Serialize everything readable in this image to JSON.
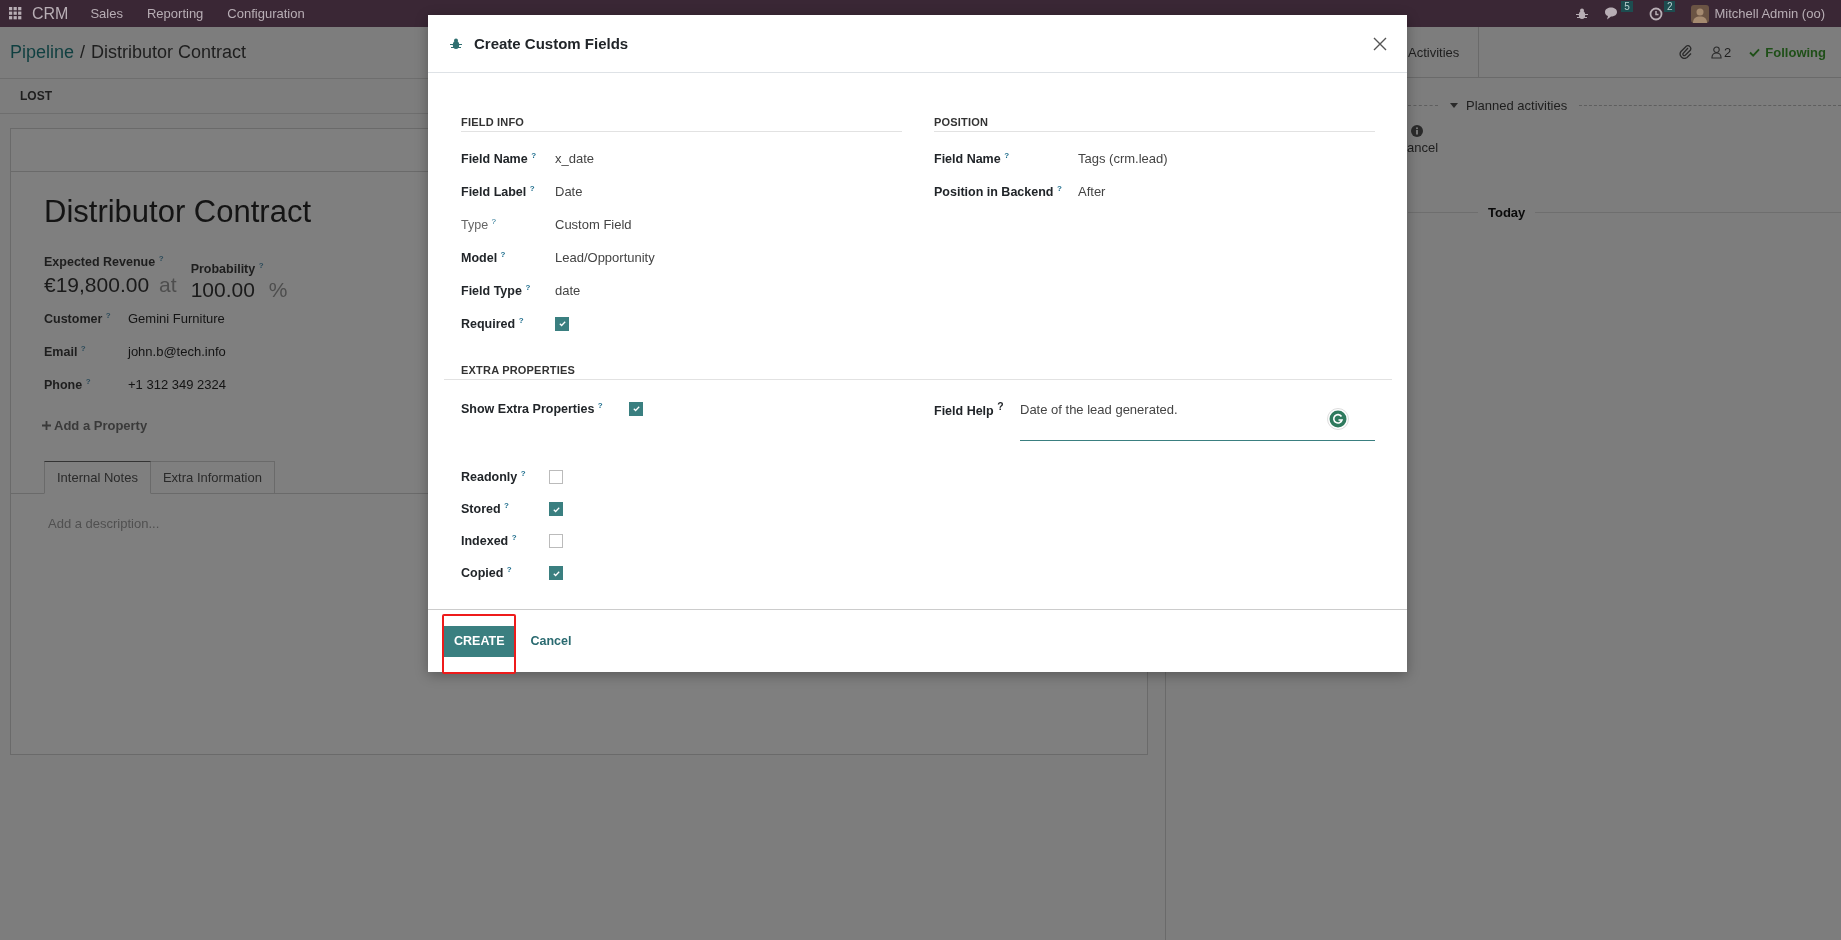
{
  "navbar": {
    "app": "CRM",
    "menus": [
      "Sales",
      "Reporting",
      "Configuration"
    ],
    "messages_count": "5",
    "activities_count": "2",
    "user": "Mitchell Admin (oo)"
  },
  "breadcrumb": {
    "parent": "Pipeline",
    "separator": "/",
    "current": "Distributor Contract"
  },
  "status_buttons": [
    "LOST"
  ],
  "record": {
    "title": "Distributor Contract",
    "revenue_label": "Expected Revenue $^{?}$",
    "probability_label": "Probability $^{?}$",
    "revenue": "€19,800.00",
    "at": "at",
    "probability": "100.00",
    "percent": "%",
    "fields": [
      {
        "label": "Customer $^{?}$",
        "value": "Gemini Furniture"
      },
      {
        "label": "Email $^{?}$",
        "value": "john.b@tech.info"
      },
      {
        "label": "Phone $^{?}$",
        "value": "+1 312 349 2324"
      }
    ],
    "add_property": "Add a Property",
    "tabs": [
      {
        "label": "Internal Notes",
        "selected": true
      },
      {
        "label": "Extra Information",
        "selected": false
      }
    ],
    "description_placeholder": "Add a description..."
  },
  "chatter": {
    "tab": "Activities",
    "followers_count": "2",
    "follow_label": "Following",
    "planned_label": "Planned activities",
    "cut_text": "ancel",
    "today": "Today"
  },
  "dialog": {
    "title": "Create Custom Fields",
    "field_info": {
      "heading": "FIELD INFO",
      "rows": [
        {
          "kind": "text",
          "label": "Field Name $^{?}$",
          "value": "x_date",
          "muted": false
        },
        {
          "kind": "text",
          "label": "Field Label $^{?}$",
          "value": "Date",
          "muted": false
        },
        {
          "kind": "text",
          "label": "Type $^{?}$",
          "value": "Custom Field",
          "muted": true
        },
        {
          "kind": "text",
          "label": "Model $^{?}$",
          "value": "Lead/Opportunity",
          "muted": false
        },
        {
          "kind": "text",
          "label": "Field Type $^{?}$",
          "value": "date",
          "muted": false
        },
        {
          "kind": "checkbox",
          "label": "Required $^{?}$",
          "checked": true,
          "muted": false
        }
      ]
    },
    "position": {
      "heading": "POSITION",
      "rows": [
        {
          "kind": "text",
          "label": "Field Name $^{?}$",
          "value": "Tags (crm.lead)",
          "muted": false
        },
        {
          "kind": "text",
          "label": "Position in Backend $^{?}$",
          "value": "After",
          "muted": false
        }
      ]
    },
    "extra": {
      "heading": "EXTRA PROPERTIES",
      "show_extra": {
        "label": "Show Extra Properties $^{?}$",
        "checked": true
      },
      "field_help": {
        "label": "Field Help $^{?}$",
        "value": "Date of the lead generated."
      },
      "flags": [
        {
          "label": "Readonly $^{?}$",
          "checked": false
        },
        {
          "label": "Stored $^{?}$",
          "checked": true
        },
        {
          "label": "Indexed $^{?}$",
          "checked": false
        },
        {
          "label": "Copied $^{?}$",
          "checked": true
        }
      ]
    },
    "create": {
      "label": "CREATE",
      "highlighted": true
    },
    "cancel": "Cancel"
  }
}
